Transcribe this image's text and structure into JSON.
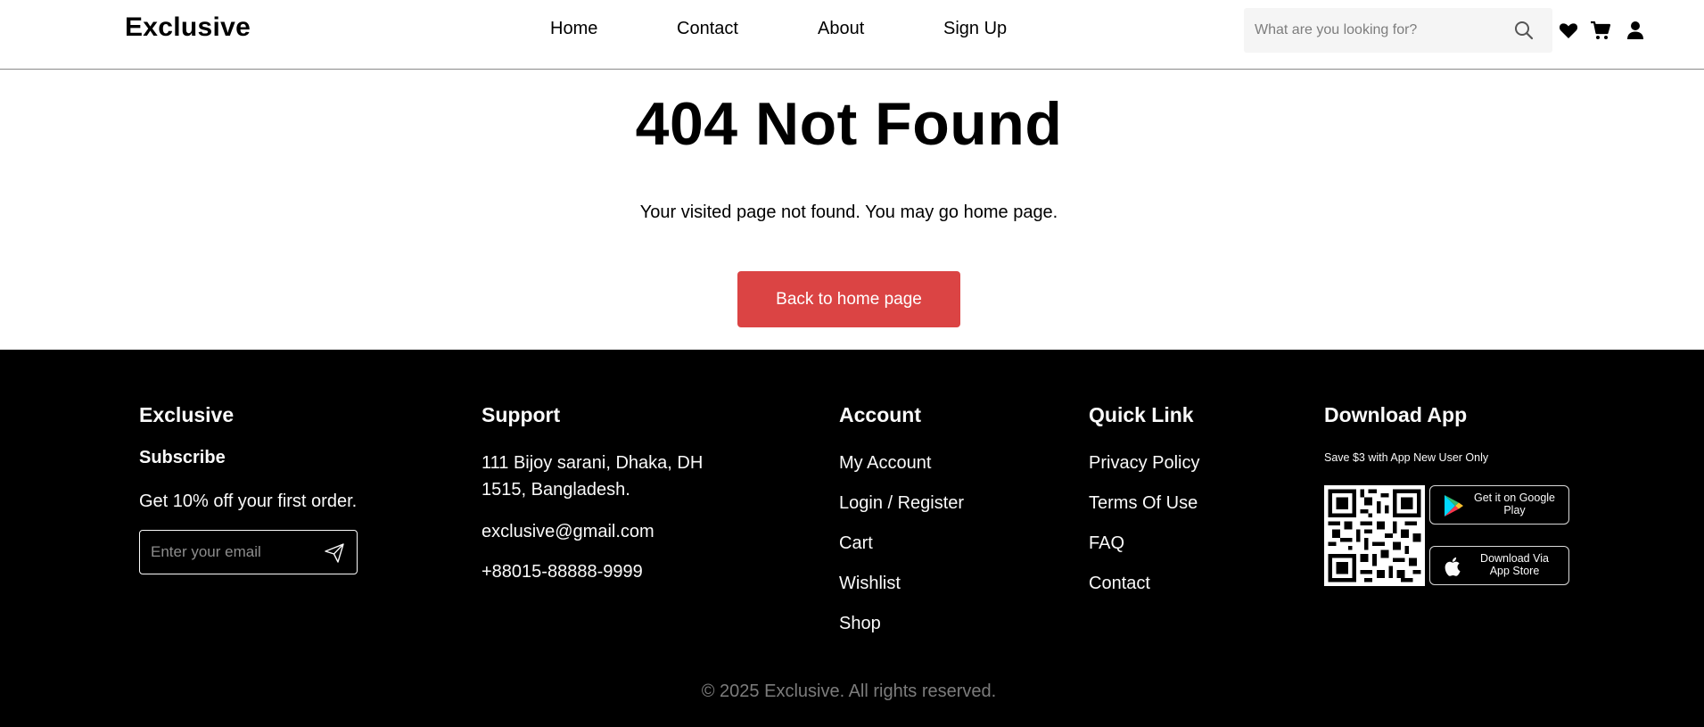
{
  "header": {
    "logo": "Exclusive",
    "nav": [
      "Home",
      "Contact",
      "About",
      "Sign Up"
    ],
    "search_placeholder": "What are you looking for?",
    "icons": [
      "search-icon",
      "heart-icon",
      "cart-icon",
      "user-icon"
    ]
  },
  "main": {
    "title": "404 Not Found",
    "description": "Your visited page not found. You may go home page.",
    "button_label": "Back to home page",
    "button_color": "#db4444"
  },
  "footer": {
    "brand": {
      "heading": "Exclusive",
      "subheading": "Subscribe",
      "offer": "Get 10% off your first order.",
      "email_placeholder": "Enter your email"
    },
    "support": {
      "heading": "Support",
      "address_line1": "111 Bijoy sarani, Dhaka, DH",
      "address_line2": "1515, Bangladesh.",
      "email": "exclusive@gmail.com",
      "phone": "+88015-88888-9999"
    },
    "account": {
      "heading": "Account",
      "links": [
        "My Account",
        "Login / Register",
        "Cart",
        "Wishlist",
        "Shop"
      ]
    },
    "quick_link": {
      "heading": "Quick Link",
      "links": [
        "Privacy Policy",
        "Terms Of Use",
        "FAQ",
        "Contact"
      ]
    },
    "download": {
      "heading": "Download App",
      "note": "Save $3 with App New User Only",
      "google_play_line1": "Get it on Google",
      "google_play_line2": "Play",
      "app_store_line1": "Download Via",
      "app_store_line2": "App Store"
    },
    "copyright": "© 2025 Exclusive. All rights reserved.",
    "background": "#000000"
  }
}
